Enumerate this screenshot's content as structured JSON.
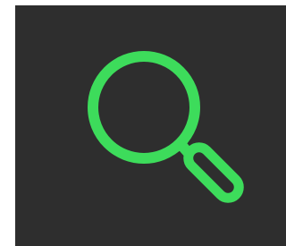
{
  "app": {
    "icon": {
      "name": "magnifying-glass-icon",
      "meaning": "search"
    },
    "colors": {
      "background": "#2e2e2e",
      "accent": "#3ddc5b"
    }
  }
}
